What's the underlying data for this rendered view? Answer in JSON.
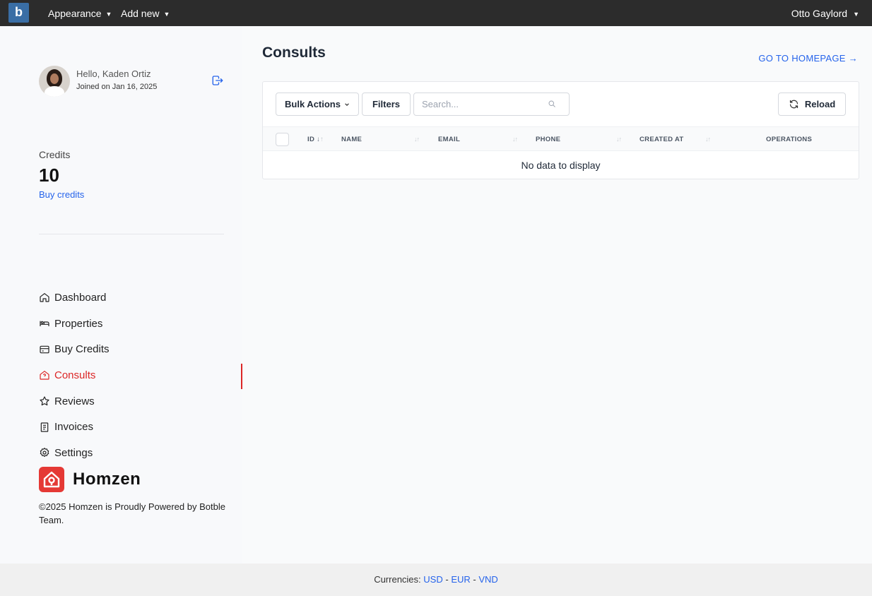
{
  "topbar": {
    "logo": "b",
    "menus": [
      "Appearance",
      "Add new"
    ],
    "user_name": "Otto Gaylord"
  },
  "profile": {
    "greeting": "Hello, Kaden Ortiz",
    "joined": "Joined on Jan 16, 2025"
  },
  "credits": {
    "label": "Credits",
    "value": "10",
    "buy_link": "Buy credits"
  },
  "nav": {
    "items": [
      {
        "label": "Dashboard",
        "icon": "home-icon"
      },
      {
        "label": "Properties",
        "icon": "bed-icon"
      },
      {
        "label": "Buy Credits",
        "icon": "credit-card-icon"
      },
      {
        "label": "Consults",
        "icon": "home-question-icon",
        "active": true
      },
      {
        "label": "Reviews",
        "icon": "star-icon"
      },
      {
        "label": "Invoices",
        "icon": "receipt-icon"
      },
      {
        "label": "Settings",
        "icon": "gear-icon"
      }
    ]
  },
  "brand": {
    "name": "Homzen",
    "copyright": "©2025 Homzen is Proudly Powered by Botble Team.",
    "accent": "#e53935"
  },
  "main": {
    "title": "Consults",
    "home_link": "GO TO HOMEPAGE →"
  },
  "toolbar": {
    "bulk_actions": "Bulk Actions",
    "filters": "Filters",
    "search_placeholder": "Search...",
    "reload": "Reload"
  },
  "table": {
    "columns": [
      "ID",
      "NAME",
      "EMAIL",
      "PHONE",
      "CREATED AT",
      "OPERATIONS"
    ],
    "empty_message": "No data to display",
    "rows": []
  },
  "footer": {
    "label": "Currencies:",
    "currencies": [
      "USD",
      "EUR",
      "VND"
    ],
    "separator": " - "
  },
  "colors": {
    "active": "#dc2626",
    "link": "#2563eb",
    "topbar": "#2c2c2c"
  }
}
